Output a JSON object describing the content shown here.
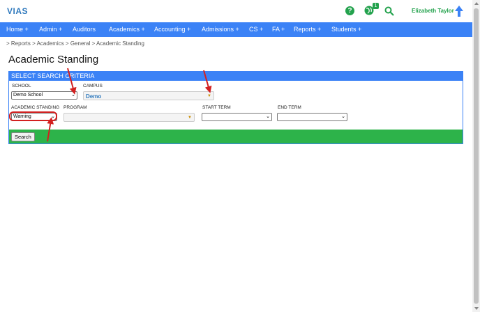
{
  "app": {
    "logo": "VIAS",
    "user_name": "Elizabeth Taylor",
    "notification_count": "1"
  },
  "nav": {
    "items": [
      "Home +",
      "Admin +",
      "Auditors",
      "Academics +",
      "Accounting +",
      "Admissions +",
      "CS +",
      "FA +",
      "Reports +",
      "Students +"
    ]
  },
  "breadcrumb": "> Reports  > Academics  > General  > Academic Standing",
  "page_title": "Academic Standing",
  "criteria": {
    "header": "SELECT SEARCH CRITERIA",
    "school_label": "SCHOOL",
    "school_value": "Demo School",
    "campus_label": "CAMPUS",
    "campus_value": "Demo",
    "standing_label": "ACADEMIC STANDING",
    "standing_value": "Warning",
    "program_label": "PROGRAM",
    "start_term_label": "START TERM",
    "end_term_label": "END TERM",
    "search_label": "Search"
  },
  "colors": {
    "nav_blue": "#3b82f6",
    "accent_green": "#2db34a",
    "annotation_red": "#d32020"
  },
  "icons": [
    "help-icon",
    "globe-icon",
    "search-icon",
    "user-arrow-icon",
    "chevron-down-icon"
  ]
}
